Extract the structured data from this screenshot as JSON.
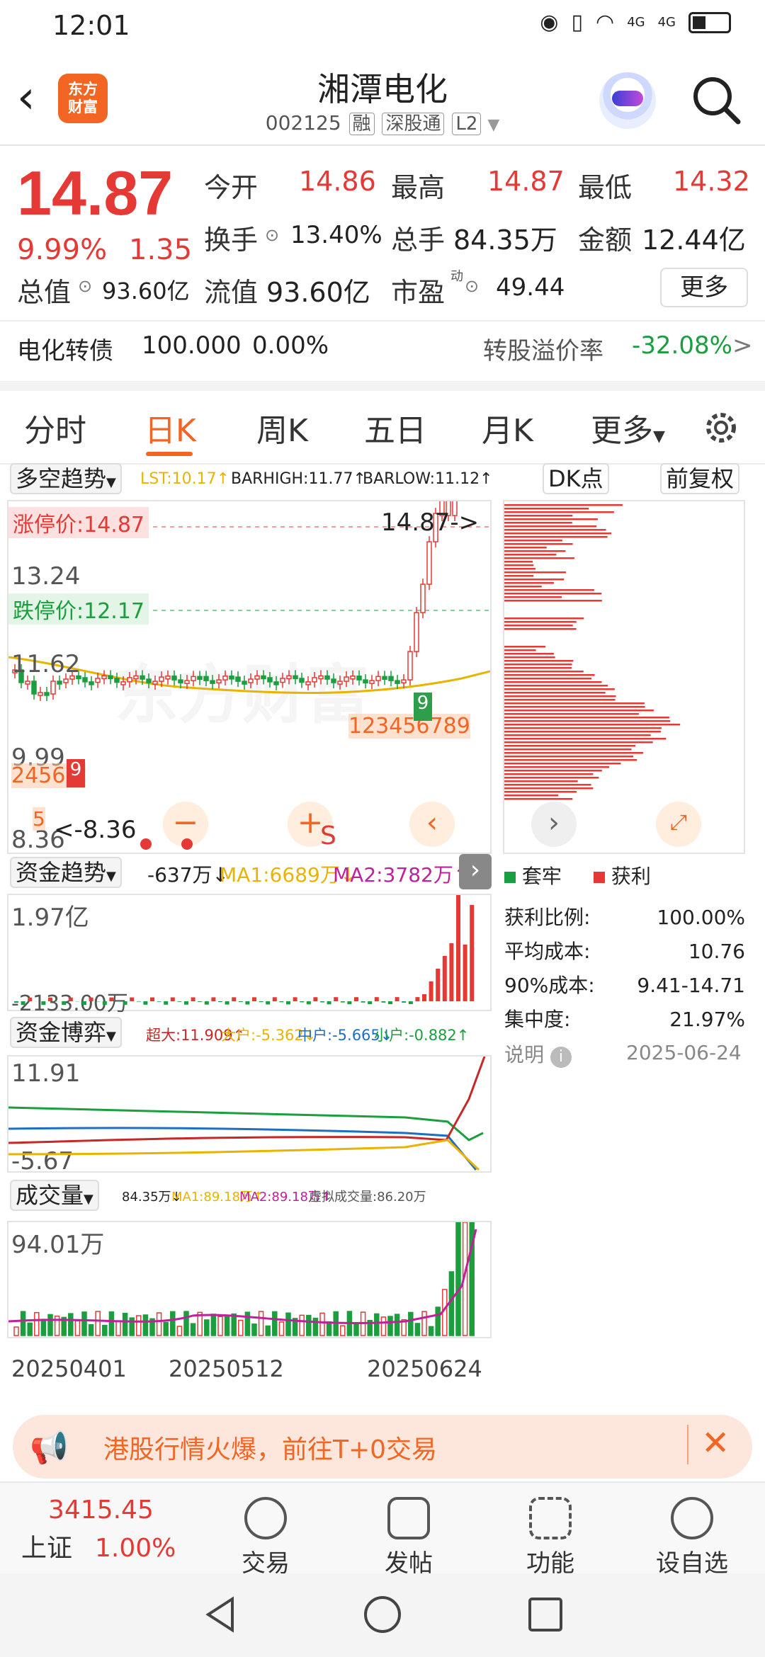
{
  "status": {
    "time": "12:01",
    "signal1": "4G",
    "signal2": "4G"
  },
  "header": {
    "back_icon": "chevron-left-icon",
    "logo_text": "东方\n财富",
    "title": "湘潭电化",
    "code": "002125",
    "tags": [
      "融",
      "深股通",
      "L2"
    ]
  },
  "quote": {
    "price": "14.87",
    "change_pct": "9.99%",
    "change": "1.35",
    "open_label": "今开",
    "open": "14.86",
    "high_label": "最高",
    "high": "14.87",
    "low_label": "最低",
    "low": "14.32",
    "turnover_label": "换手",
    "turnover": "13.40%",
    "volume_label": "总手",
    "volume": "84.35万",
    "amount_label": "金额",
    "amount": "12.44亿",
    "mktcap_label": "总值",
    "mktcap": "93.60亿",
    "float_label": "流值",
    "float": "93.60亿",
    "pe_label": "市盈",
    "pe_sup": "动",
    "pe": "49.44",
    "more_label": "更多"
  },
  "bond": {
    "name": "电化转债",
    "price": "100.000",
    "pct": "0.00%",
    "premium_label": "转股溢价率",
    "premium": "-32.08%",
    "arrow": ">"
  },
  "tabs": [
    "分时",
    "日K",
    "周K",
    "五日",
    "月K",
    "更多"
  ],
  "kline": {
    "indicator": "多空趋势",
    "lst": "LST:10.17↑",
    "barhigh": "BARHIGH:11.77↑",
    "barlow": "BARLOW:11.12↑",
    "dk_btn": "DK点",
    "adj_btn": "前复权",
    "limit_up": "涨停价:14.87",
    "limit_down": "跌停价:12.17",
    "y_labels": [
      "13.24",
      "11.62",
      "9.99",
      "8.36"
    ],
    "price_tag": "14.87->",
    "low_tag": "<-8.36",
    "seq_text": "123456789",
    "minus": "−",
    "plus": "+",
    "s_label": "S",
    "watermark": "东方财富",
    "count_9": "9",
    "count_5": "5",
    "seq_left": "2456 7"
  },
  "fund": {
    "indicator": "资金趋势",
    "value": "-637万↓",
    "ma1": "MA1:6689万↓",
    "ma2": "MA2:3782万↑",
    "top": "1.97亿",
    "bottom": "-2133.00万"
  },
  "game": {
    "indicator": "资金博弈",
    "super": "超大:11.909↑",
    "big": "大户:-5.362↓",
    "mid": "中户:-5.665↓",
    "small": "小户:-0.882↑",
    "top": "11.91",
    "bottom": "-5.67"
  },
  "vol": {
    "indicator": "成交量",
    "value": "84.35万↓",
    "ma1": "MA1:89.18万↑",
    "ma2": "MA2:89.18万↑",
    "virt": "虚拟成交量:86.20万",
    "top": "94.01万",
    "dates": [
      "20250401",
      "20250512",
      "20250624"
    ]
  },
  "chip": {
    "legend_trap": "套牢",
    "legend_profit": "获利",
    "rows": [
      [
        "获利比例:",
        "100.00%"
      ],
      [
        "平均成本:",
        "10.76"
      ],
      [
        "90%成本:",
        "9.41-14.71"
      ],
      [
        "集中度:",
        "21.97%"
      ]
    ],
    "note": "说明",
    "date": "2025-06-24"
  },
  "banner": {
    "text": "港股行情火爆，前往T+0交易"
  },
  "bottom": {
    "index_value": "3415.45",
    "index_name": "上证",
    "index_pct": "1.00%",
    "items": [
      "交易",
      "发帖",
      "功能",
      "设自选"
    ]
  },
  "colors": {
    "up": "#e53935",
    "down": "#1b9e3e",
    "accent": "#f26522"
  }
}
